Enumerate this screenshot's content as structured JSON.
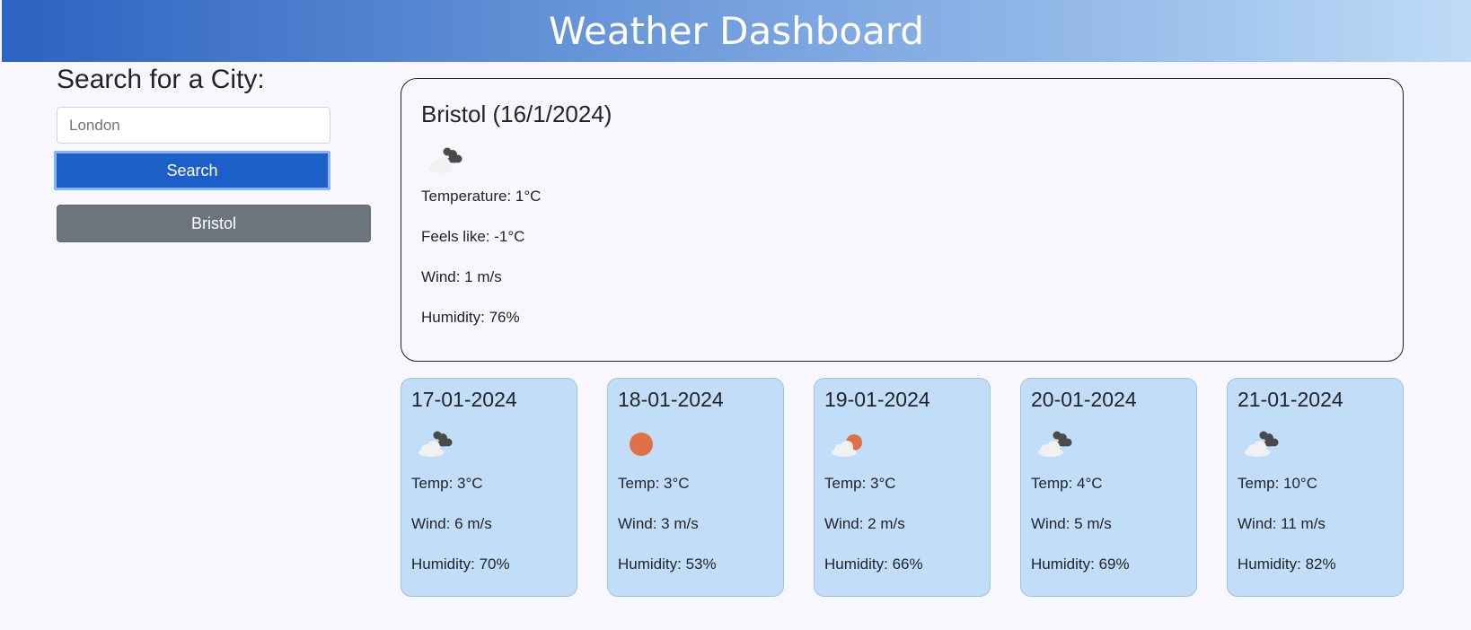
{
  "header": {
    "title": "Weather Dashboard"
  },
  "search": {
    "title": "Search for a City:",
    "placeholder": "London",
    "button_label": "Search"
  },
  "history": [
    {
      "label": "Bristol"
    }
  ],
  "current": {
    "heading": "Bristol (16/1/2024)",
    "icon": "broken-clouds-icon",
    "temperature": "Temperature: 1°C",
    "feels_like": "Feels like: -1°C",
    "wind": "Wind: 1 m/s",
    "humidity": "Humidity: 76%"
  },
  "forecast": [
    {
      "date": "17-01-2024",
      "icon": "broken-clouds-icon",
      "temp": "Temp: 3°C",
      "wind": "Wind: 6 m/s",
      "humidity": "Humidity: 70%"
    },
    {
      "date": "18-01-2024",
      "icon": "clear-sky-icon",
      "temp": "Temp: 3°C",
      "wind": "Wind: 3 m/s",
      "humidity": "Humidity: 53%"
    },
    {
      "date": "19-01-2024",
      "icon": "few-clouds-icon",
      "temp": "Temp: 3°C",
      "wind": "Wind: 2 m/s",
      "humidity": "Humidity: 66%"
    },
    {
      "date": "20-01-2024",
      "icon": "broken-clouds-icon",
      "temp": "Temp: 4°C",
      "wind": "Wind: 5 m/s",
      "humidity": "Humidity: 69%"
    },
    {
      "date": "21-01-2024",
      "icon": "broken-clouds-icon",
      "temp": "Temp: 10°C",
      "wind": "Wind: 11 m/s",
      "humidity": "Humidity: 82%"
    }
  ],
  "colors": {
    "primary": "#1d5fc8",
    "secondary": "#6c757d",
    "card_bg": "#c1ddf8",
    "sun": "#e07048"
  }
}
